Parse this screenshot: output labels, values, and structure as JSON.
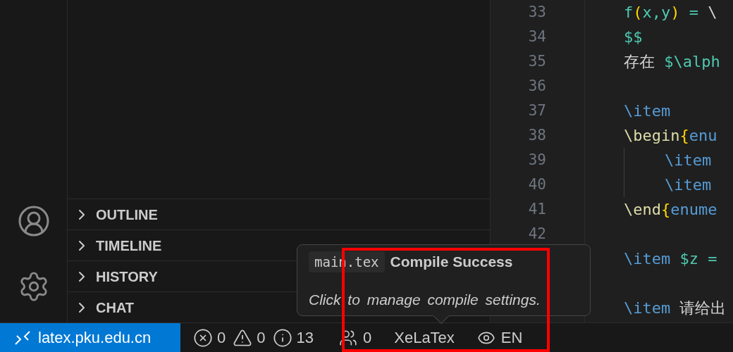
{
  "panel_sections": [
    {
      "label": "OUTLINE",
      "expanded": false
    },
    {
      "label": "TIMELINE",
      "expanded": false
    },
    {
      "label": "HISTORY",
      "expanded": false
    },
    {
      "label": "CHAT",
      "expanded": false
    }
  ],
  "editor": {
    "lines": [
      {
        "number": "33",
        "indent": false,
        "tokens": [
          {
            "kind": "math",
            "text": "f"
          },
          {
            "kind": "brace",
            "text": "("
          },
          {
            "kind": "math",
            "text": "x,y"
          },
          {
            "kind": "brace",
            "text": ")"
          },
          {
            "kind": "math",
            "text": " = "
          },
          {
            "kind": "plain",
            "text": "\\"
          }
        ]
      },
      {
        "number": "34",
        "indent": false,
        "tokens": [
          {
            "kind": "math",
            "text": "$$"
          }
        ]
      },
      {
        "number": "35",
        "indent": false,
        "tokens": [
          {
            "kind": "plain",
            "text": "存在 "
          },
          {
            "kind": "math",
            "text": "$\\alph"
          }
        ]
      },
      {
        "number": "36",
        "indent": false
      },
      {
        "number": "37",
        "indent": false,
        "tokens": [
          {
            "kind": "command",
            "text": "\\item"
          }
        ]
      },
      {
        "number": "38",
        "indent": false,
        "tokens": [
          {
            "kind": "keyword",
            "text": "\\begin"
          },
          {
            "kind": "brace",
            "text": "{"
          },
          {
            "kind": "command",
            "text": "enu"
          }
        ]
      },
      {
        "number": "39",
        "indent": true,
        "tokens": [
          {
            "kind": "command",
            "text": "\\item"
          }
        ]
      },
      {
        "number": "40",
        "indent": true,
        "tokens": [
          {
            "kind": "command",
            "text": "\\item"
          }
        ]
      },
      {
        "number": "41",
        "indent": false,
        "tokens": [
          {
            "kind": "keyword",
            "text": "\\end"
          },
          {
            "kind": "brace",
            "text": "{"
          },
          {
            "kind": "command",
            "text": "enume"
          }
        ]
      },
      {
        "number": "42",
        "indent": false
      },
      {
        "indent": false,
        "tokens": [
          {
            "kind": "command",
            "text": "\\item"
          },
          {
            "kind": "math",
            "text": " $z ="
          }
        ]
      },
      {
        "indent": false
      },
      {
        "indent": false,
        "tokens": [
          {
            "kind": "command",
            "text": "\\item"
          },
          {
            "kind": "plain",
            "text": " 请给出"
          }
        ]
      }
    ]
  },
  "status_bar": {
    "remote": "latex.pku.edu.cn",
    "errors": "0",
    "warnings": "0",
    "infos": "13",
    "collaborators": "0",
    "compiler": "XeLaTex",
    "language": "EN"
  },
  "tooltip": {
    "file": "main.tex",
    "title": "Compile Success",
    "message": "Click to manage compile settings."
  }
}
